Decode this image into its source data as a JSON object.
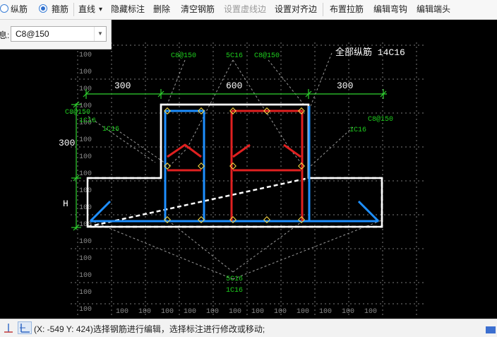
{
  "toolbar": {
    "longitudinal_label": "纵筋",
    "stirrup_label": "箍筋",
    "line_label": "直线",
    "line_arrow": "▾",
    "hide_dims_label": "隐藏标注",
    "delete_label": "删除",
    "clear_rebar_label": "清空钢筋",
    "set_dashed_label": "设置虚线边",
    "set_align_label": "设置对齐边",
    "place_tie_label": "布置拉筋",
    "edit_hook_label": "编辑弯钩",
    "edit_end_label": "编辑端头"
  },
  "rebar_combo": {
    "label": "息:",
    "value": "C8@150"
  },
  "drawing": {
    "grid_label": "100",
    "top_rebar_label": "5C16",
    "stirrup_label_top_left": "C8@150",
    "stirrup_label_top_right": "C8@150",
    "all_longitudinal_label": "全部纵筋 14C16",
    "dim_left": "300",
    "dim_middle": "600",
    "dim_right": "300",
    "left_stirrup_label": "C8@150",
    "left_corner_rebar": "1C16",
    "left_flange_rebar": "1C16",
    "right_stirrup_label": "C8@150",
    "right_flange_rebar": "1C16",
    "dim_web_height": "300",
    "dim_flange_height": "H",
    "bottom_rebar_label": "5C16",
    "bottom_corner_rebar": "1C16"
  },
  "statusbar": {
    "message": "(X: -549 Y: 424)选择钢筋进行编辑，选择标注进行修改或移动;"
  },
  "colors": {
    "canvas_bg": "#000000",
    "grid": "#7a7a7a",
    "label_green": "#1ecc1e",
    "dim_green": "#2fd12f",
    "stirrup_blue": "#1e8fff",
    "stirrup_red": "#e02020",
    "outline": "#ffffff",
    "rebar_point": "#ffdd44"
  }
}
